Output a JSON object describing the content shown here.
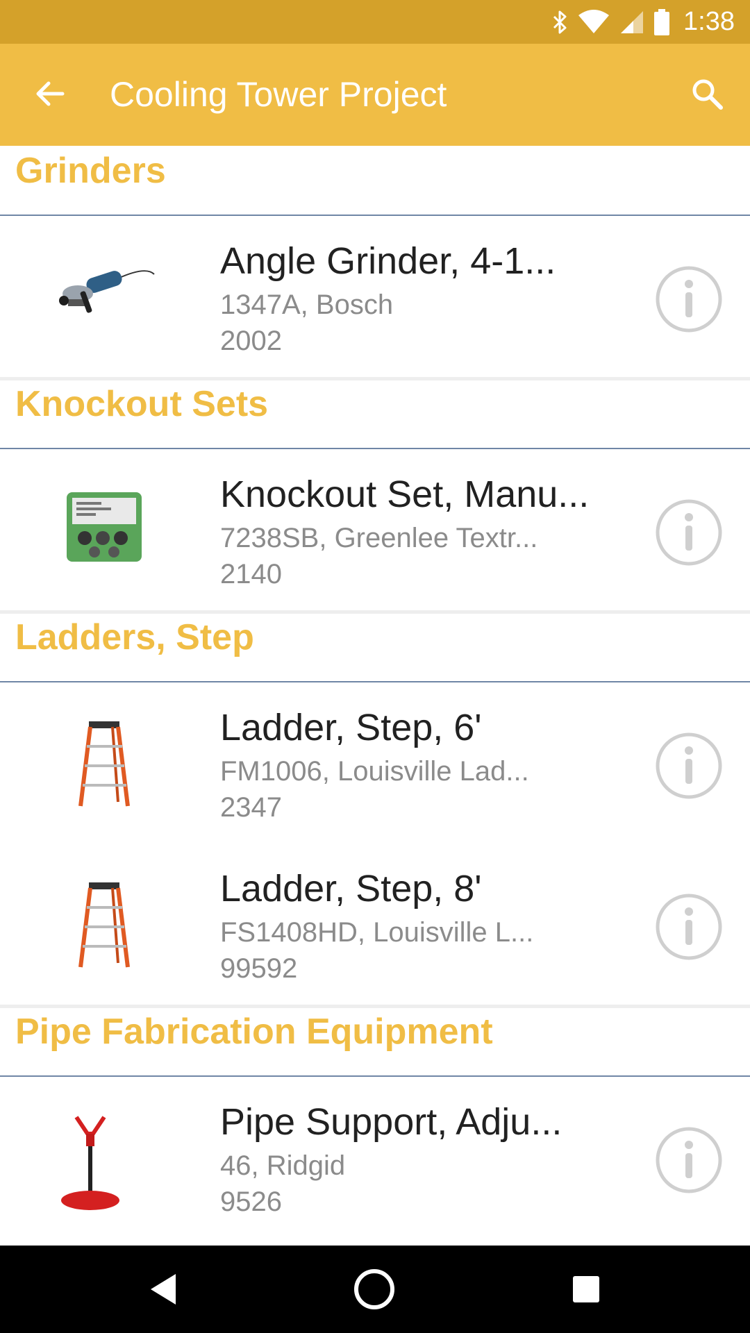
{
  "status_bar": {
    "time": "1:38",
    "icons": [
      "bluetooth-icon",
      "wifi-icon",
      "cell-signal-icon",
      "battery-icon"
    ]
  },
  "app_bar": {
    "title": "Cooling Tower Project",
    "back_icon": "arrow-back-icon",
    "search_icon": "search-icon"
  },
  "colors": {
    "status_bar": "#d4a12a",
    "app_bar": "#f0bd45",
    "section_header_text": "#f0bd45",
    "divider": "#6f86a6",
    "nav_bar": "#000000"
  },
  "sections": [
    {
      "title": "Grinders",
      "items": [
        {
          "name": "Angle Grinder, 4-1...",
          "subtitle": "1347A, Bosch",
          "id": "2002",
          "image": "angle-grinder"
        }
      ]
    },
    {
      "title": "Knockout Sets",
      "items": [
        {
          "name": "Knockout Set, Manu...",
          "subtitle": "7238SB, Greenlee Textr...",
          "id": "2140",
          "image": "knockout-set"
        }
      ]
    },
    {
      "title": "Ladders, Step",
      "items": [
        {
          "name": "Ladder, Step, 6'",
          "subtitle": "FM1006, Louisville Lad...",
          "id": "2347",
          "image": "step-ladder"
        },
        {
          "name": "Ladder, Step, 8'",
          "subtitle": "FS1408HD, Louisville L...",
          "id": "99592",
          "image": "step-ladder"
        }
      ]
    },
    {
      "title": "Pipe Fabrication Equipment",
      "items": [
        {
          "name": "Pipe Support, Adju...",
          "subtitle": "46, Ridgid",
          "id": "9526",
          "image": "pipe-support"
        }
      ]
    }
  ],
  "nav_bar": {
    "icons": [
      "nav-back-icon",
      "nav-home-icon",
      "nav-recents-icon"
    ]
  }
}
